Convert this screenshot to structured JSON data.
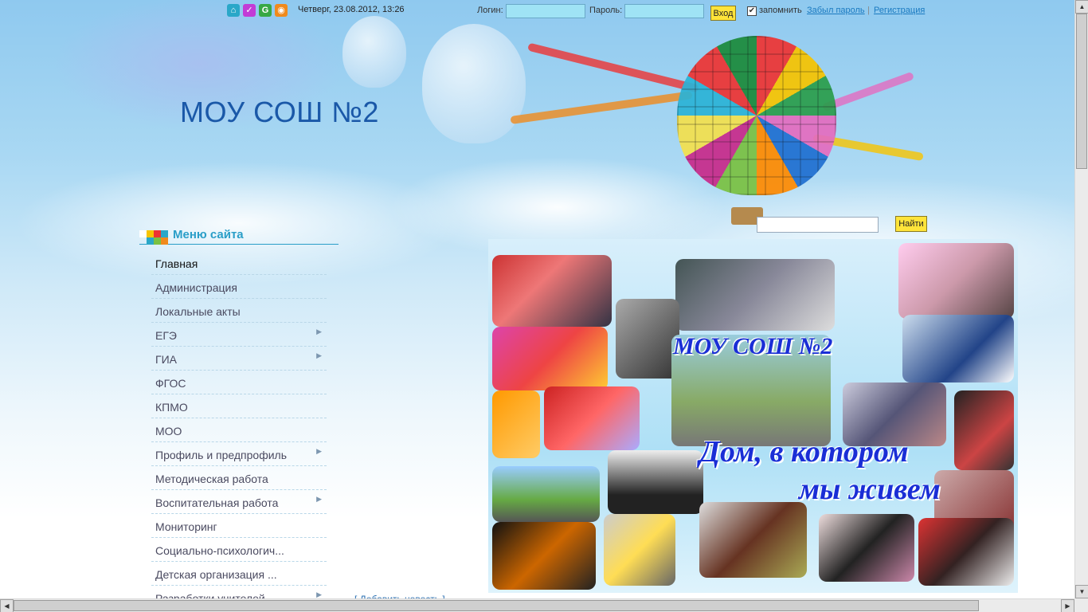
{
  "topbar": {
    "icons": [
      {
        "name": "home-icon",
        "color": "#2aa7c8",
        "glyph": "⌂"
      },
      {
        "name": "check-icon",
        "color": "#c23bd6",
        "glyph": "✓"
      },
      {
        "name": "refresh-icon",
        "color": "#37a844",
        "glyph": "G"
      },
      {
        "name": "rss-icon",
        "color": "#f08a1c",
        "glyph": "◉"
      }
    ],
    "datetime": "Четверг, 23.08.2012, 13:26",
    "login_label": "Логин:",
    "login_value": "",
    "password_label": "Пароль:",
    "password_value": "",
    "login_button": "Вход",
    "remember_checked": true,
    "remember_label": "запомнить",
    "forgot_link": "Забыл пароль",
    "separator": "|",
    "register_link": "Регистрация"
  },
  "site_title": "МОУ СОШ №2",
  "search": {
    "value": "",
    "button": "Найти"
  },
  "menu": {
    "title": "Меню сайта",
    "items": [
      {
        "label": "Главная",
        "submenu": false
      },
      {
        "label": "Администрация",
        "submenu": false
      },
      {
        "label": "Локальные акты",
        "submenu": false
      },
      {
        "label": "ЕГЭ",
        "submenu": true
      },
      {
        "label": "ГИА",
        "submenu": true
      },
      {
        "label": "ФГОС",
        "submenu": false
      },
      {
        "label": "КПМО",
        "submenu": false
      },
      {
        "label": "МОО",
        "submenu": false
      },
      {
        "label": "Профиль и предпрофиль",
        "submenu": true
      },
      {
        "label": "Методическая работа",
        "submenu": false
      },
      {
        "label": "Воспитательная работа",
        "submenu": true
      },
      {
        "label": "Мониторинг",
        "submenu": false
      },
      {
        "label": "Социально-психологич...",
        "submenu": false
      },
      {
        "label": "Детская организация ...",
        "submenu": false
      },
      {
        "label": "Разработки учителей",
        "submenu": true
      }
    ],
    "arrow_glyph": "▶"
  },
  "add_news": "[ Добавить новость ]",
  "collage": {
    "title": "МОУ СОШ №2",
    "motto_line1": "Дом, в котором",
    "motto_line2": "мы живем"
  },
  "scrollbar": {
    "up": "▲",
    "down": "▼",
    "left": "◀",
    "right": "▶"
  }
}
